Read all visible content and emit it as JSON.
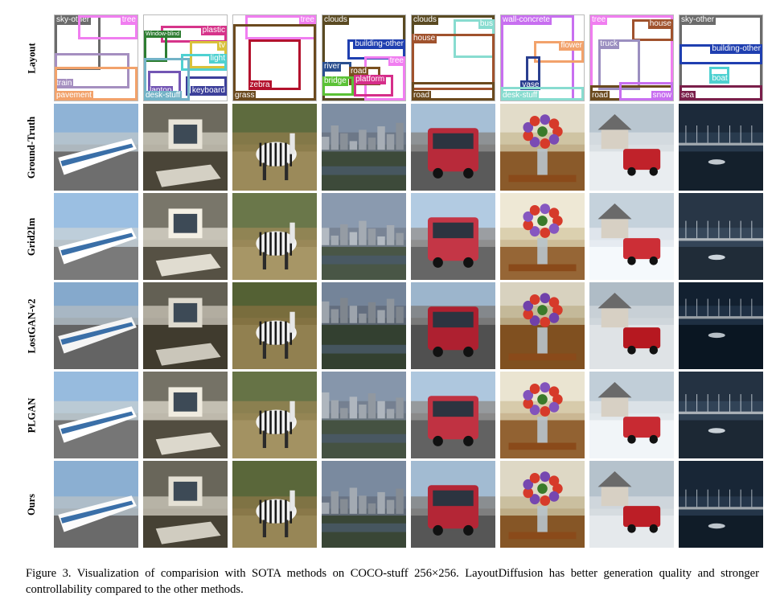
{
  "row_labels": [
    "Layout",
    "Ground-Truth",
    "Grid2Im",
    "LostGAN-v2",
    "PLGAN",
    "Ours"
  ],
  "layouts": [
    {
      "name": "train",
      "boxes": [
        {
          "label": "sky-other",
          "color": "#6b6b6b",
          "tag": "tl"
        },
        {
          "label": "tree",
          "color": "#f07ef0",
          "tag": "tr"
        },
        {
          "label": "train",
          "color": "#a58fc0",
          "tag": "bl"
        },
        {
          "label": "pavement",
          "color": "#f2a26b",
          "tag": "bl"
        }
      ]
    },
    {
      "name": "desk",
      "boxes": [
        {
          "label": "plastic",
          "color": "#d6348a",
          "tag": "tr"
        },
        {
          "label": "Window-blind",
          "color": "#2e7d32",
          "tag": "tl",
          "small": true
        },
        {
          "label": "tv",
          "color": "#d9c23b",
          "tag": "tr"
        },
        {
          "label": "light",
          "color": "#4fd1d1",
          "tag": "tr"
        },
        {
          "label": "laptop",
          "color": "#7356b4",
          "tag": "bl"
        },
        {
          "label": "keyboard",
          "color": "#3c3f9a",
          "tag": "br"
        },
        {
          "label": "desk-stuff",
          "color": "#73b3c7",
          "tag": "bl"
        }
      ]
    },
    {
      "name": "zebra",
      "boxes": [
        {
          "label": "tree",
          "color": "#f07ef0",
          "tag": "tr"
        },
        {
          "label": "zebra",
          "color": "#b3122d",
          "tag": "bl"
        },
        {
          "label": "grass",
          "color": "#6b4a1e",
          "tag": "bl"
        }
      ]
    },
    {
      "name": "city",
      "boxes": [
        {
          "label": "clouds",
          "color": "#5a4a22",
          "tag": "tl"
        },
        {
          "label": "building-other",
          "color": "#1f3fb0",
          "tag": "tr"
        },
        {
          "label": "tree",
          "color": "#f07ef0",
          "tag": "tr"
        },
        {
          "label": "river",
          "color": "#2a4f8f",
          "tag": "tl"
        },
        {
          "label": "road",
          "color": "#7a5020",
          "tag": "tl"
        },
        {
          "label": "bridge",
          "color": "#5bc236",
          "tag": "tl"
        },
        {
          "label": "platform",
          "color": "#d62e8a",
          "tag": "tl"
        }
      ]
    },
    {
      "name": "bus",
      "boxes": [
        {
          "label": "clouds",
          "color": "#5a4a22",
          "tag": "tl"
        },
        {
          "label": "bus",
          "color": "#88dcd0",
          "tag": "tr"
        },
        {
          "label": "house",
          "color": "#a0522d",
          "tag": "tl"
        },
        {
          "label": "road",
          "color": "#6b4a1e",
          "tag": "bl"
        }
      ]
    },
    {
      "name": "flower",
      "boxes": [
        {
          "label": "wall-concrete",
          "color": "#c86ff0",
          "tag": "tl"
        },
        {
          "label": "flower",
          "color": "#f2a26b",
          "tag": "tr"
        },
        {
          "label": "vase",
          "color": "#2a3f8f",
          "tag": "br"
        },
        {
          "label": "desk-stuff",
          "color": "#88dcd0",
          "tag": "bl"
        }
      ]
    },
    {
      "name": "truck",
      "boxes": [
        {
          "label": "tree",
          "color": "#f07ef0",
          "tag": "tl"
        },
        {
          "label": "house",
          "color": "#a0522d",
          "tag": "tr"
        },
        {
          "label": "truck",
          "color": "#9b8fc0",
          "tag": "tl"
        },
        {
          "label": "road",
          "color": "#6b4a1e",
          "tag": "bl"
        },
        {
          "label": "snow",
          "color": "#c86ff0",
          "tag": "br"
        }
      ]
    },
    {
      "name": "harbor",
      "boxes": [
        {
          "label": "sky-other",
          "color": "#6b6b6b",
          "tag": "tl"
        },
        {
          "label": "building-other",
          "color": "#1f3fb0",
          "tag": "tr"
        },
        {
          "label": "boat",
          "color": "#4fd1d1",
          "tag": "br"
        },
        {
          "label": "sea",
          "color": "#7a1f4a",
          "tag": "bl"
        }
      ]
    }
  ],
  "caption": "Figure 3. Visualization of comparision with SOTA methods on COCO-stuff 256×256. LayoutDiffusion has better generation quality and stronger controllability compared to the other methods."
}
